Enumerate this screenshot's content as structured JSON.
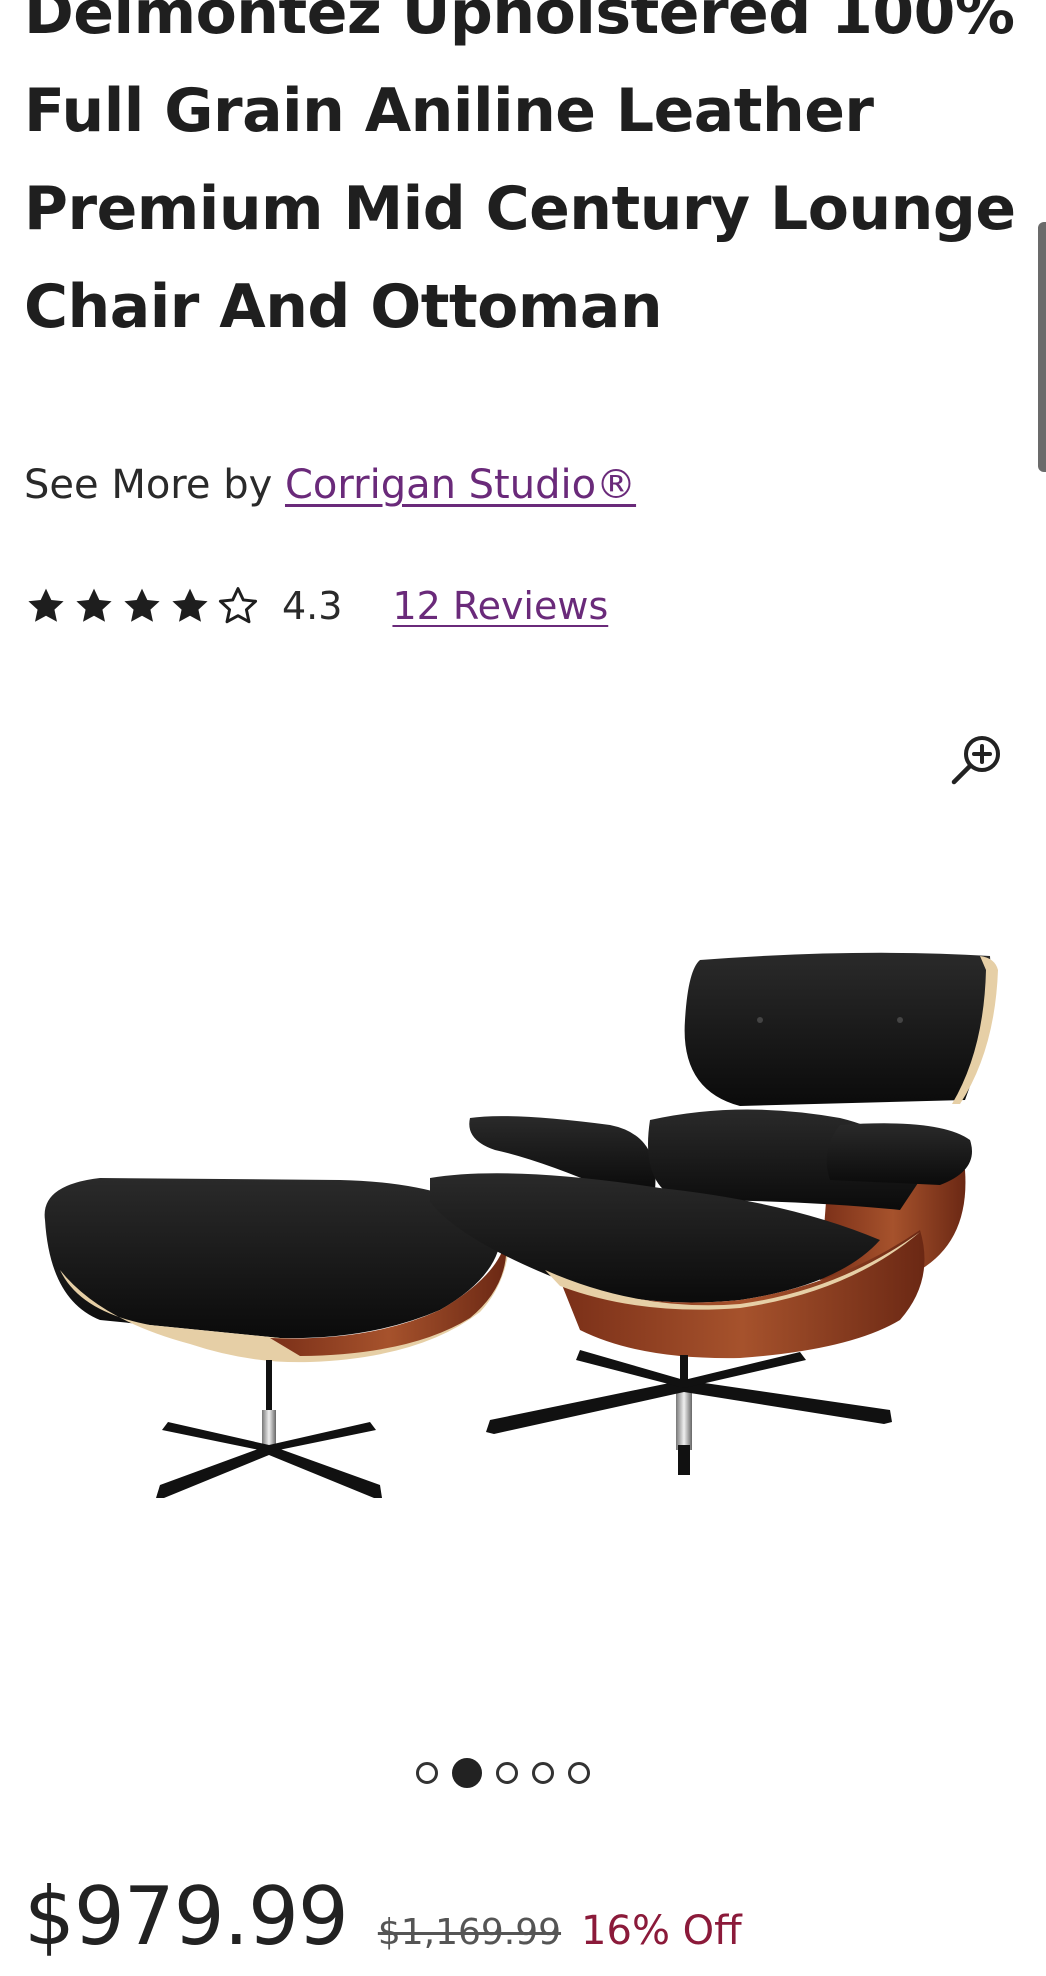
{
  "product": {
    "title": "Delmontez Upholstered 100% Full Grain Aniline Leather Premium Mid Century Lounge Chair And Ottoman",
    "by_prefix": "See More by ",
    "brand": "Corrigan Studio®",
    "rating": {
      "value": "4.3",
      "stars_filled": 4,
      "stars_total": 5,
      "reviews_label": "12 Reviews"
    },
    "image": {
      "alt_icon": "zoom-in-icon",
      "current_index": 2,
      "total": 5
    },
    "price": {
      "current": "$979.99",
      "original": "$1,169.99",
      "discount": "16% Off"
    }
  },
  "colors": {
    "link": "#6a2a7a",
    "discount": "#8b1a3a",
    "text": "#222222"
  }
}
